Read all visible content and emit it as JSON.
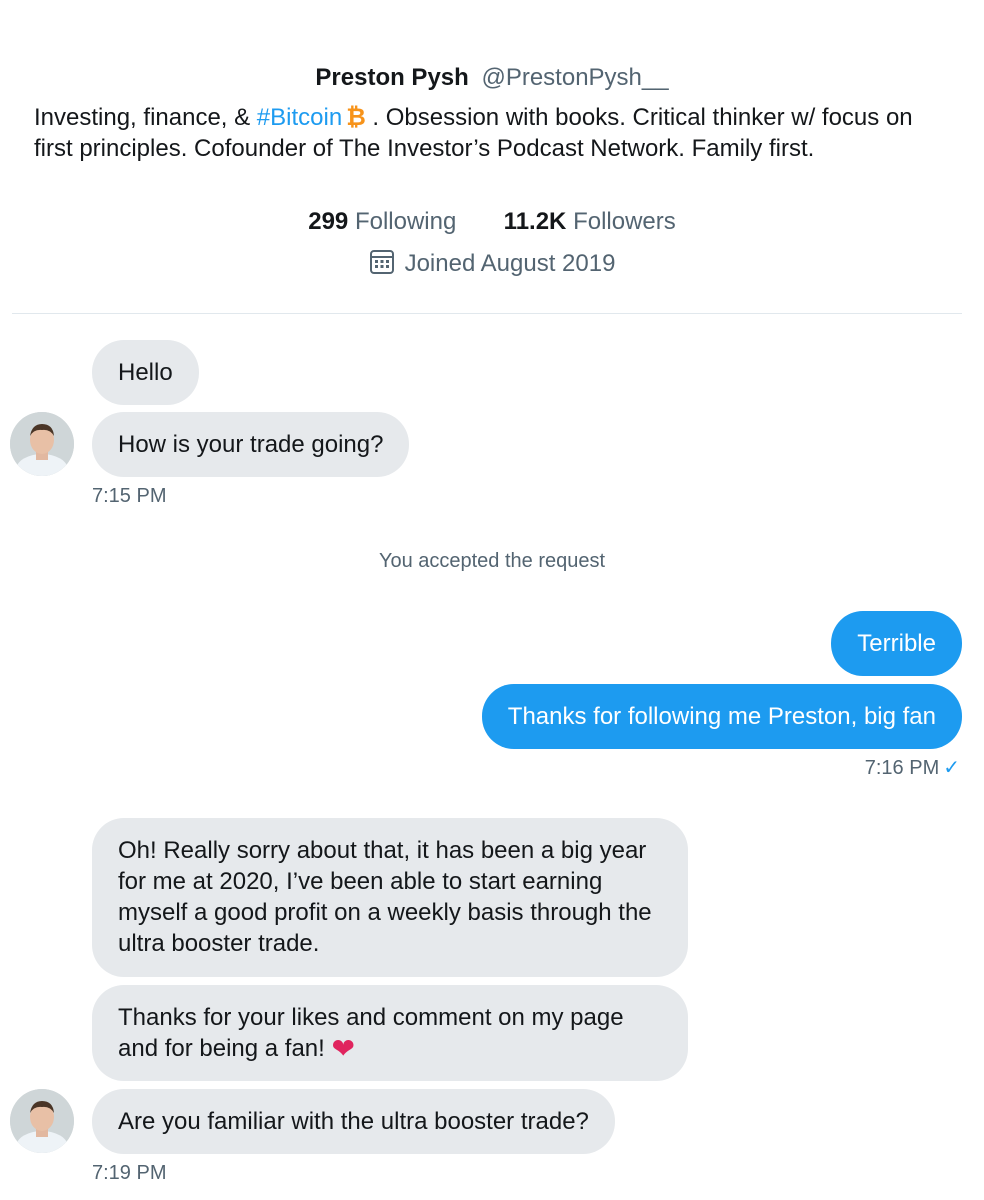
{
  "profile": {
    "name": "Preston Pysh",
    "handle": "@PrestonPysh__",
    "bio_prefix": "Investing, finance, & ",
    "bio_hashtag": "#Bitcoin",
    "bio_icon": "₿",
    "bio_suffix": " . Obsession with books. Critical thinker w/ focus on first principles. Cofounder of The Investor’s Podcast Network. Family first.",
    "following_count": "299",
    "following_label": "Following",
    "followers_count": "11.2K",
    "followers_label": "Followers",
    "joined": "Joined August 2019"
  },
  "conversation": {
    "group1": {
      "messages": [
        "Hello",
        "How is your trade going?"
      ],
      "time": "7:15 PM"
    },
    "system_note": "You accepted the request",
    "group2": {
      "messages": [
        "Terrible",
        "Thanks for following me Preston, big fan"
      ],
      "time": "7:16 PM",
      "read_mark": "✓"
    },
    "group3": {
      "messages": [
        "Oh! Really sorry about that, it has been a big year for me at 2020, I’ve been able to start earning myself a good profit on a weekly basis through the ultra booster trade.",
        "Thanks for your likes and comment on my page and for being a fan!",
        "Are you familiar with the ultra booster trade?"
      ],
      "heart": "❤",
      "time": "7:19 PM"
    }
  },
  "icons": {
    "calendar": "calendar-icon",
    "bitcoin": "bitcoin-icon",
    "avatar": "avatar",
    "heart": "heart-icon"
  },
  "colors": {
    "accent": "#1d9bf0",
    "incoming_bubble": "#e6e9ec",
    "bitcoin": "#f7931a",
    "heart": "#e0245e",
    "muted_text": "#536471"
  }
}
